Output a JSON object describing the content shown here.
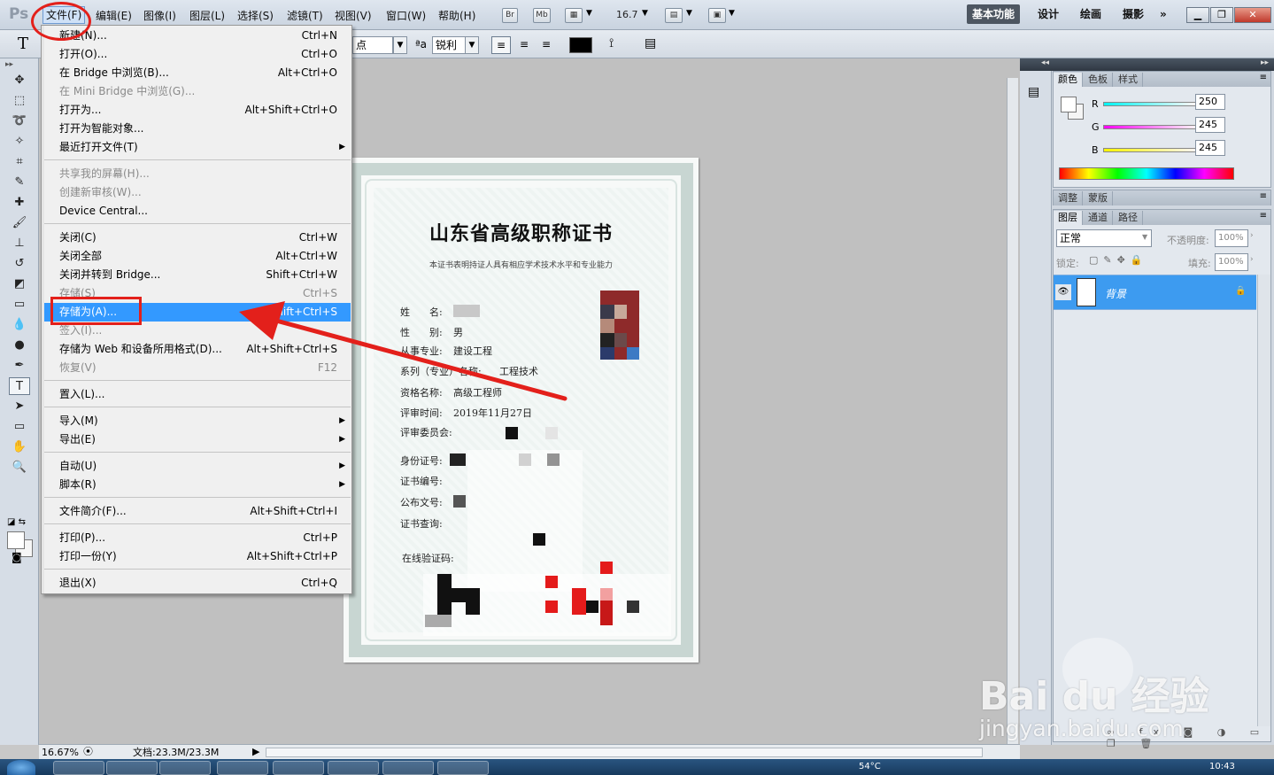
{
  "app": {
    "logo": "Ps"
  },
  "menubar": {
    "items": [
      "文件(F)",
      "编辑(E)",
      "图像(I)",
      "图层(L)",
      "选择(S)",
      "滤镜(T)",
      "视图(V)",
      "窗口(W)",
      "帮助(H)"
    ],
    "br": "Br",
    "mb": "Mb",
    "zoom": "16.7",
    "workspaces": [
      "基本功能",
      "设计",
      "绘画",
      "摄影"
    ],
    "more": "»"
  },
  "options": {
    "font_size": "点",
    "aa_label": "ªa",
    "aa_value": "锐利"
  },
  "file_menu": {
    "items": [
      {
        "label": "新建(N)...",
        "shortcut": "Ctrl+N"
      },
      {
        "label": "打开(O)...",
        "shortcut": "Ctrl+O"
      },
      {
        "label": "在 Bridge 中浏览(B)...",
        "shortcut": "Alt+Ctrl+O"
      },
      {
        "label": "在 Mini Bridge 中浏览(G)...",
        "shortcut": ""
      },
      {
        "label": "打开为...",
        "shortcut": "Alt+Shift+Ctrl+O"
      },
      {
        "label": "打开为智能对象...",
        "shortcut": ""
      },
      {
        "label": "最近打开文件(T)",
        "shortcut": ""
      },
      {
        "label": "共享我的屏幕(H)...",
        "shortcut": ""
      },
      {
        "label": "创建新审核(W)...",
        "shortcut": ""
      },
      {
        "label": "Device Central...",
        "shortcut": ""
      },
      {
        "label": "关闭(C)",
        "shortcut": "Ctrl+W"
      },
      {
        "label": "关闭全部",
        "shortcut": "Alt+Ctrl+W"
      },
      {
        "label": "关闭并转到 Bridge...",
        "shortcut": "Shift+Ctrl+W"
      },
      {
        "label": "存储(S)",
        "shortcut": "Ctrl+S"
      },
      {
        "label": "存储为(A)...",
        "shortcut": "Shift+Ctrl+S"
      },
      {
        "label": "签入(I)...",
        "shortcut": ""
      },
      {
        "label": "存储为 Web 和设备所用格式(D)...",
        "shortcut": "Alt+Shift+Ctrl+S"
      },
      {
        "label": "恢复(V)",
        "shortcut": "F12"
      },
      {
        "label": "置入(L)...",
        "shortcut": ""
      },
      {
        "label": "导入(M)",
        "shortcut": ""
      },
      {
        "label": "导出(E)",
        "shortcut": ""
      },
      {
        "label": "自动(U)",
        "shortcut": ""
      },
      {
        "label": "脚本(R)",
        "shortcut": ""
      },
      {
        "label": "文件简介(F)...",
        "shortcut": "Alt+Shift+Ctrl+I"
      },
      {
        "label": "打印(P)...",
        "shortcut": "Ctrl+P"
      },
      {
        "label": "打印一份(Y)",
        "shortcut": "Alt+Shift+Ctrl+P"
      },
      {
        "label": "退出(X)",
        "shortcut": "Ctrl+Q"
      }
    ],
    "submenu_arrow": "▶"
  },
  "certificate": {
    "title": "山东省高级职称证书",
    "subtitle": "本证书表明持证人具有相应学术技术水平和专业能力",
    "fields": [
      {
        "label": "姓　　名:",
        "value": ""
      },
      {
        "label": "性　　别:",
        "value": "男"
      },
      {
        "label": "从事专业:",
        "value": "建设工程"
      },
      {
        "label": "系列（专业）名称:",
        "value": "工程技术"
      },
      {
        "label": "资格名称:",
        "value": "高级工程师"
      },
      {
        "label": "评审时间:",
        "value": "2019年11月27日"
      },
      {
        "label": "评审委员会:",
        "value": ""
      },
      {
        "label": "身份证号:",
        "value": ""
      },
      {
        "label": "证书编号:",
        "value": ""
      },
      {
        "label": "公布文号:",
        "value": ""
      },
      {
        "label": "证书查询:",
        "value": ""
      },
      {
        "label": "在线验证码:",
        "value": ""
      }
    ]
  },
  "color_panel": {
    "tabs": [
      "颜色",
      "色板",
      "样式"
    ],
    "r_label": "R",
    "g_label": "G",
    "b_label": "B",
    "r": "250",
    "g": "245",
    "b": "245"
  },
  "adjust_panel": {
    "tabs": [
      "调整",
      "蒙版"
    ]
  },
  "layers_panel": {
    "tabs": [
      "图层",
      "通道",
      "路径"
    ],
    "blend_mode": "正常",
    "opacity_label": "不透明度:",
    "opacity": "100%",
    "lock_label": "锁定:",
    "fill_label": "填充:",
    "fill": "100%",
    "layer_name": "背景"
  },
  "status": {
    "zoom": "16.67%",
    "doc": "文档:23.3M/23.3M"
  },
  "taskbar": {
    "temp": "54°C",
    "time": "10:43"
  },
  "watermark": {
    "brand": "Bai du 经验",
    "url": "jingyan.baidu.com"
  },
  "colors": {
    "menu_highlight": "#3399ff",
    "annotation": "#e3201b",
    "layer_selected": "#3d9bf0"
  }
}
